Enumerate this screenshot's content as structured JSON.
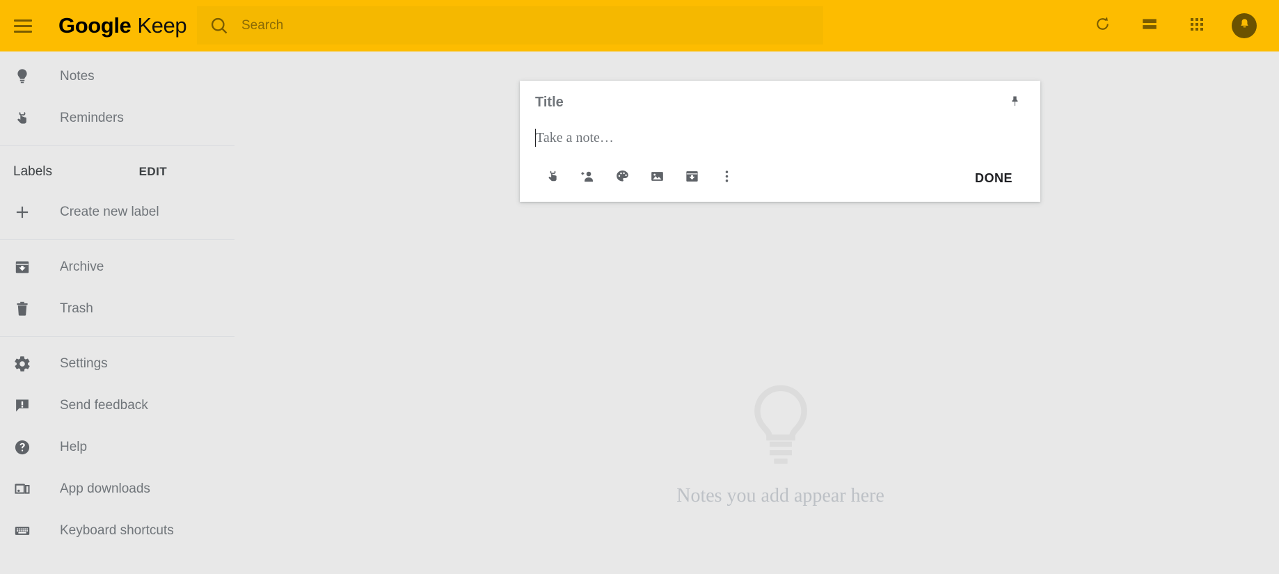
{
  "header": {
    "menu_icon": "hamburger-menu-icon",
    "brand_google": "Google",
    "brand_keep": "Keep",
    "search": {
      "icon": "search-icon",
      "placeholder": "Search",
      "value": ""
    },
    "actions": [
      {
        "name": "refresh-button",
        "icon": "refresh-icon"
      },
      {
        "name": "list-view-button",
        "icon": "list-view-icon"
      },
      {
        "name": "google-apps-button",
        "icon": "apps-grid-icon"
      },
      {
        "name": "account-button",
        "icon": "account-bell-icon"
      }
    ],
    "background_color": "#fdbc00",
    "search_background_color": "#f5b800"
  },
  "sidebar": {
    "items": [
      {
        "label": "Notes",
        "icon": "lightbulb-icon"
      },
      {
        "label": "Reminders",
        "icon": "reminder-finger-icon"
      }
    ],
    "labels_section": {
      "title": "Labels",
      "edit_label": "EDIT"
    },
    "create_label": {
      "label": "Create new label",
      "icon": "plus-icon"
    },
    "storage_items": [
      {
        "label": "Archive",
        "icon": "archive-icon"
      },
      {
        "label": "Trash",
        "icon": "trash-icon"
      }
    ],
    "footer_items": [
      {
        "label": "Settings",
        "icon": "gear-icon"
      },
      {
        "label": "Send feedback",
        "icon": "feedback-icon"
      },
      {
        "label": "Help",
        "icon": "help-circle-icon"
      },
      {
        "label": "App downloads",
        "icon": "devices-icon"
      },
      {
        "label": "Keyboard shortcuts",
        "icon": "keyboard-icon"
      }
    ]
  },
  "note_composer": {
    "title_placeholder": "Title",
    "title_value": "",
    "body_placeholder": "Take a note…",
    "body_value": "",
    "pin_icon": "pin-icon",
    "toolbar": [
      {
        "name": "remind-me-button",
        "icon": "reminder-finger-icon"
      },
      {
        "name": "collaborator-button",
        "icon": "person-add-icon"
      },
      {
        "name": "background-options-button",
        "icon": "color-palette-icon"
      },
      {
        "name": "add-image-button",
        "icon": "image-icon"
      },
      {
        "name": "archive-button",
        "icon": "archive-icon"
      },
      {
        "name": "more-options-button",
        "icon": "more-vertical-icon"
      }
    ],
    "done_label": "DONE"
  },
  "empty_state": {
    "icon": "lightbulb-outline-icon",
    "text": "Notes you add appear here"
  },
  "colors": {
    "page_background": "#e8e8e8",
    "card_background": "#ffffff",
    "icon_gray": "#5f6368",
    "text_gray": "#70757a",
    "empty_gray": "#dcdcdc"
  }
}
